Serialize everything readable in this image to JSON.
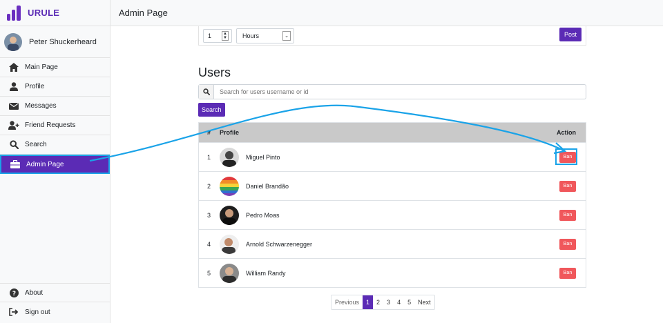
{
  "brand": {
    "name": "URULE"
  },
  "user": {
    "name": "Peter Shuckerheard"
  },
  "sidebar": {
    "items": [
      {
        "label": "Main Page",
        "icon": "home-icon"
      },
      {
        "label": "Profile",
        "icon": "user-icon"
      },
      {
        "label": "Messages",
        "icon": "envelope-icon"
      },
      {
        "label": "Friend Requests",
        "icon": "user-plus-icon"
      },
      {
        "label": "Search",
        "icon": "search-icon"
      },
      {
        "label": "Admin Page",
        "icon": "briefcase-icon",
        "active": true
      }
    ],
    "bottom": [
      {
        "label": "About",
        "icon": "question-icon"
      },
      {
        "label": "Sign out",
        "icon": "sign-out-icon"
      }
    ]
  },
  "header": {
    "title": "Admin Page"
  },
  "post": {
    "quantity": "1",
    "unit": "Hours",
    "button": "Post"
  },
  "users": {
    "title": "Users",
    "search_placeholder": "Search for users username or id",
    "search_button": "Search",
    "columns": {
      "num": "#",
      "profile": "Profile",
      "action": "Action"
    },
    "rows": [
      {
        "num": "1",
        "name": "Miguel Pinto",
        "action": "Ban"
      },
      {
        "num": "2",
        "name": "Daniel Brandão",
        "action": "Ban"
      },
      {
        "num": "3",
        "name": "Pedro Moas",
        "action": "Ban"
      },
      {
        "num": "4",
        "name": "Arnold Schwarzenegger",
        "action": "Ban"
      },
      {
        "num": "5",
        "name": "William Randy",
        "action": "Ban"
      }
    ]
  },
  "pagination": {
    "previous": "Previous",
    "pages": [
      "1",
      "2",
      "3",
      "4",
      "5"
    ],
    "next": "Next",
    "current": "1"
  },
  "colors": {
    "accent": "#5b2bb5",
    "ban": "#f0575b",
    "highlight": "#1aa3e8"
  }
}
